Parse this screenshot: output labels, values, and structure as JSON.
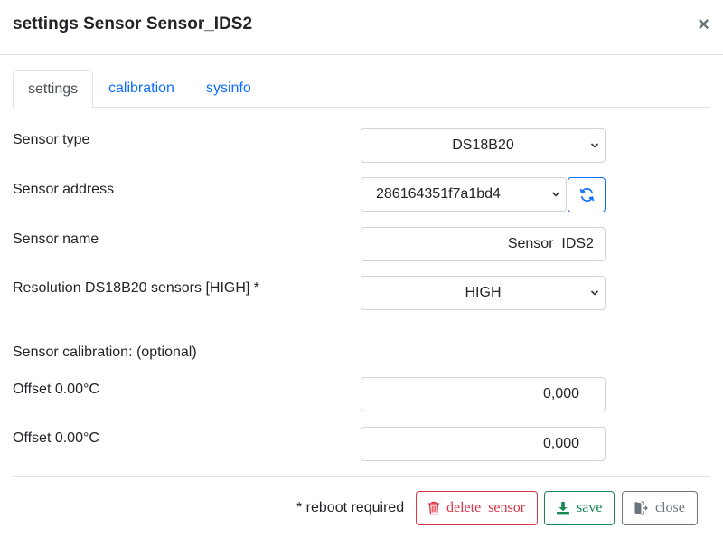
{
  "modal": {
    "title": "settings Sensor Sensor_IDS2",
    "close_glyph": "×"
  },
  "tabs": [
    {
      "label": "settings",
      "active": true
    },
    {
      "label": "calibration",
      "active": false
    },
    {
      "label": "sysinfo",
      "active": false
    }
  ],
  "form": {
    "sensor_type": {
      "label": "Sensor type",
      "value": "DS18B20"
    },
    "sensor_address": {
      "label": "Sensor address",
      "value": "286164351f7a1bd4"
    },
    "sensor_name": {
      "label": "Sensor name",
      "value": "Sensor_IDS2"
    },
    "resolution": {
      "label": "Resolution DS18B20 sensors [HIGH] *",
      "value": "HIGH"
    }
  },
  "calibration": {
    "heading": "Sensor calibration: (optional)",
    "offsets": [
      {
        "label": "Offset 0.00°C",
        "value": "0,000"
      },
      {
        "label": "Offset 0.00°C",
        "value": "0,000"
      }
    ]
  },
  "footer": {
    "note": "* reboot required",
    "delete_label": "delete  sensor",
    "save_label": "save",
    "close_label": "close"
  },
  "icons": {
    "refresh": "refresh-icon",
    "delete": "trash-icon",
    "save": "download-icon",
    "close": "door-exit-icon",
    "chevron": "chevron-down-icon"
  },
  "colors": {
    "primary": "#0d6efd",
    "danger": "#dc3545",
    "success": "#198754",
    "secondary": "#6c757d"
  }
}
